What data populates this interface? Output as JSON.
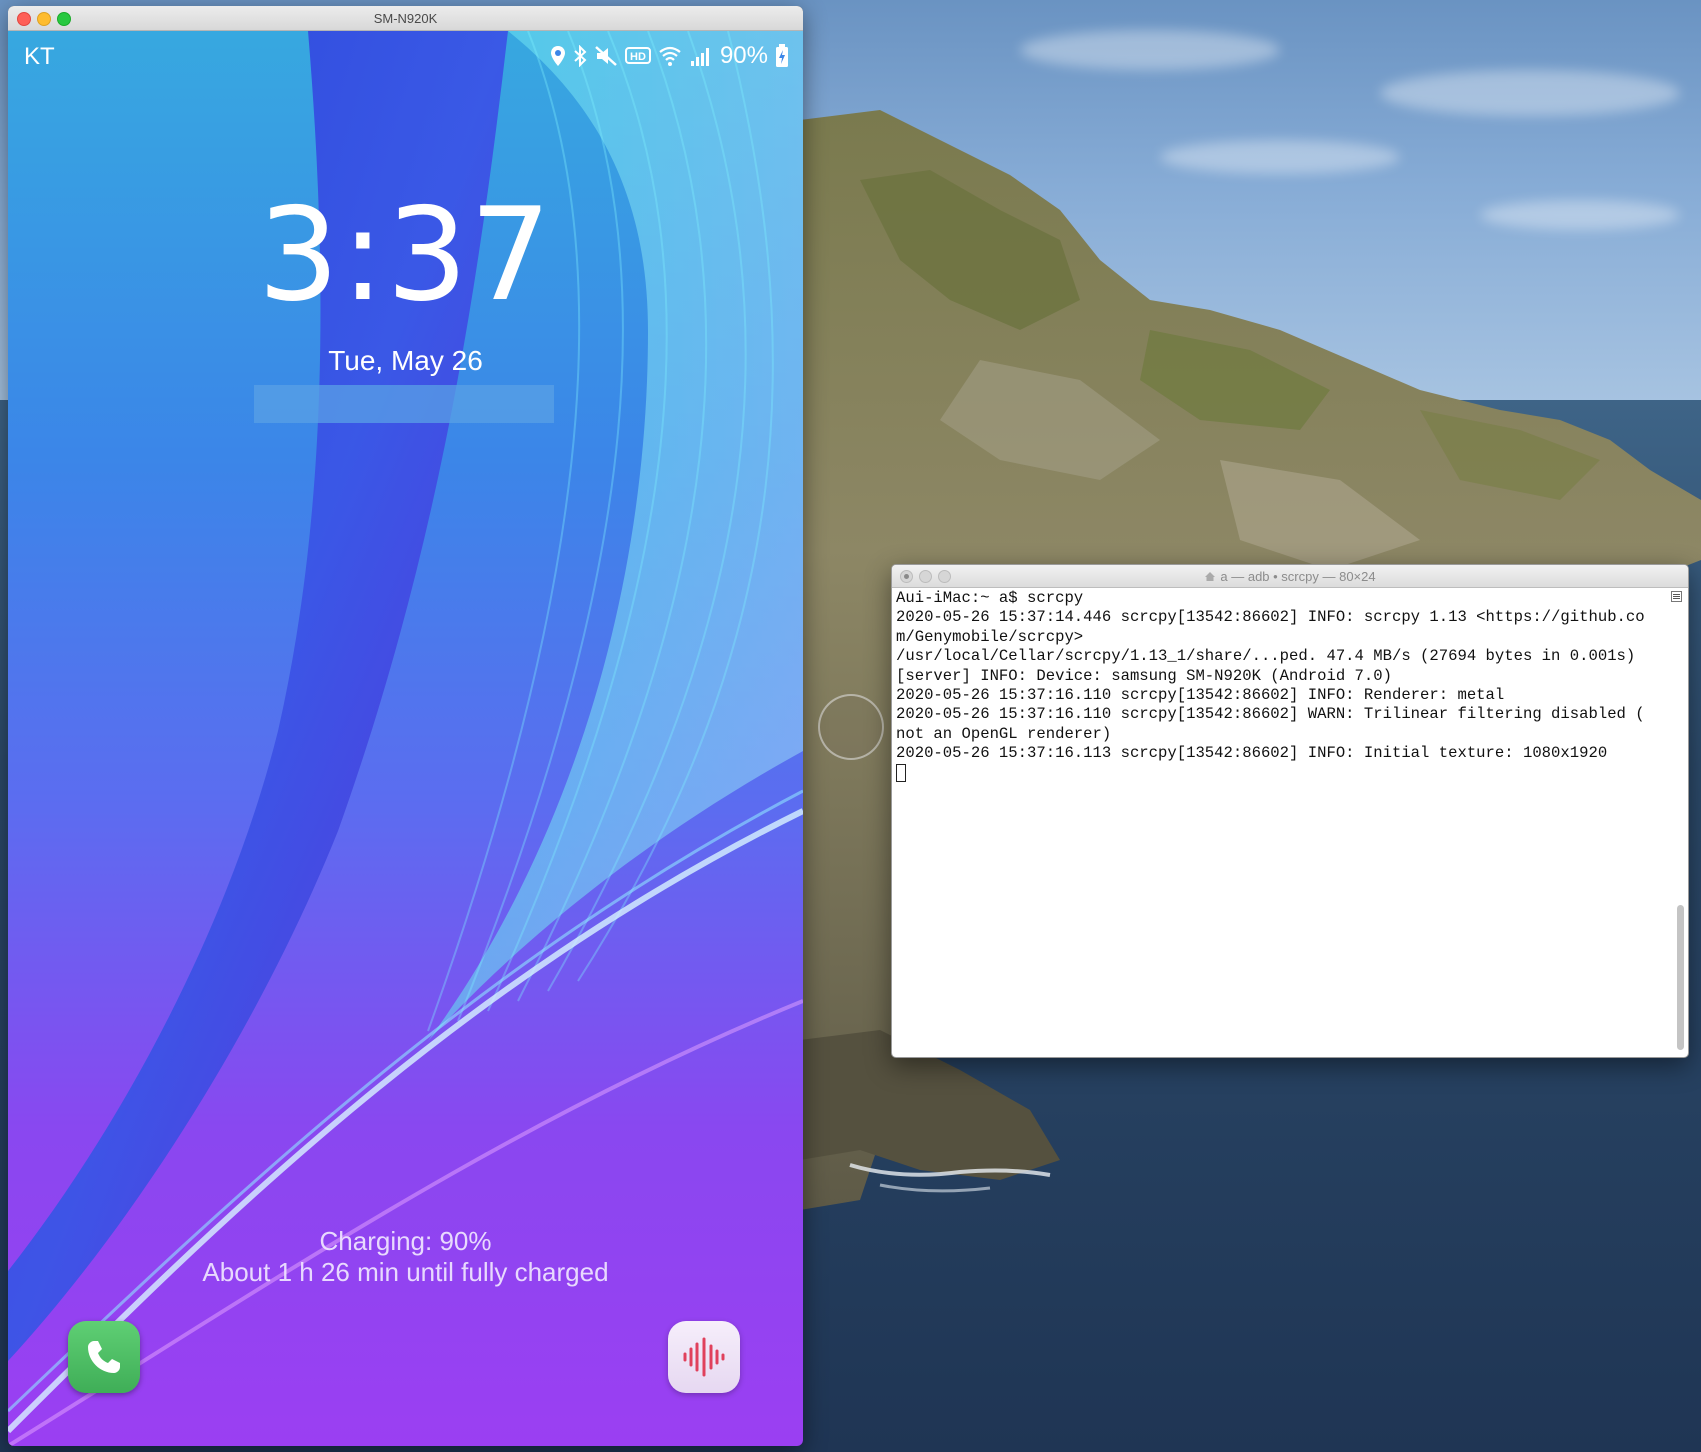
{
  "phone_window": {
    "title": "SM-N920K",
    "status_bar": {
      "carrier": "KT",
      "battery_percent": "90%",
      "icons": [
        "location-icon",
        "bluetooth-icon",
        "mute-icon",
        "hd-icon",
        "wifi-icon",
        "signal-icon",
        "battery-charging-icon"
      ]
    },
    "lock_screen": {
      "time": "3:37",
      "date": "Tue, May 26",
      "charging_status": "Charging: 90%",
      "charging_estimate": "About 1 h 26 min until fully charged",
      "shortcuts": [
        "phone-icon",
        "voice-recorder-icon"
      ]
    }
  },
  "terminal_window": {
    "title": "a — adb • scrcpy — 80×24",
    "lines": [
      "Aui-iMac:~ a$ scrcpy",
      "2020-05-26 15:37:14.446 scrcpy[13542:86602] INFO: scrcpy 1.13 <https://github.co",
      "m/Genymobile/scrcpy>",
      "/usr/local/Cellar/scrcpy/1.13_1/share/...ped. 47.4 MB/s (27694 bytes in 0.001s)",
      "[server] INFO: Device: samsung SM-N920K (Android 7.0)",
      "2020-05-26 15:37:16.110 scrcpy[13542:86602] INFO: Renderer: metal",
      "2020-05-26 15:37:16.110 scrcpy[13542:86602] WARN: Trilinear filtering disabled (",
      "not an OpenGL renderer)",
      "2020-05-26 15:37:16.113 scrcpy[13542:86602] INFO: Initial texture: 1080x1920"
    ]
  },
  "colors": {
    "wallpaper_top": "#37a8e0",
    "wallpaper_bottom": "#9b3ff2",
    "phone_button": "#4fc066",
    "voice_button": "#efe4f7",
    "voice_icon": "#e0405c"
  }
}
